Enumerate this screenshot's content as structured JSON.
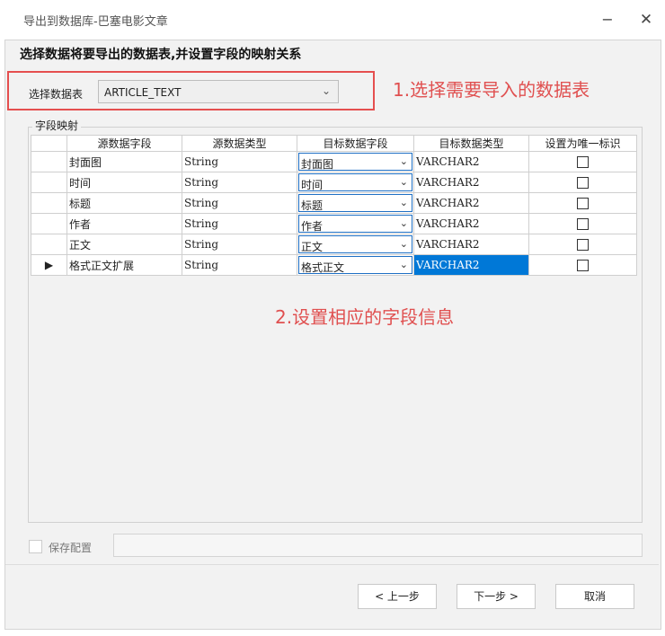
{
  "window": {
    "title": "导出到数据库-巴塞电影文章",
    "minimize_glyph": "−",
    "close_glyph": "✕"
  },
  "section_title": "选择数据将要导出的数据表,并设置字段的映射关系",
  "table_picker": {
    "label": "选择数据表",
    "value": "ARTICLE_TEXT"
  },
  "annotations": {
    "step1": "1.选择需要导入的数据表",
    "step2": "2.设置相应的字段信息"
  },
  "mapping": {
    "legend": "字段映射",
    "headers": [
      "源数据字段",
      "源数据类型",
      "目标数据字段",
      "目标数据类型",
      "设置为唯一标识"
    ],
    "current_row_marker": "▶",
    "rows": [
      {
        "source": "封面图",
        "type": "String",
        "target": "封面图",
        "target_type": "VARCHAR2",
        "unique": false
      },
      {
        "source": "时间",
        "type": "String",
        "target": "时间",
        "target_type": "VARCHAR2",
        "unique": false
      },
      {
        "source": "标题",
        "type": "String",
        "target": "标题",
        "target_type": "VARCHAR2",
        "unique": false
      },
      {
        "source": "作者",
        "type": "String",
        "target": "作者",
        "target_type": "VARCHAR2",
        "unique": false
      },
      {
        "source": "正文",
        "type": "String",
        "target": "正文",
        "target_type": "VARCHAR2",
        "unique": false
      },
      {
        "source": "格式正文扩展",
        "type": "String",
        "target": "格式正文",
        "target_type": "VARCHAR2",
        "unique": false
      }
    ]
  },
  "save_config": {
    "label": "保存配置",
    "checked": false,
    "value": ""
  },
  "buttons": {
    "prev": "< 上一步",
    "next": "下一步 >",
    "cancel": "取消"
  },
  "colors": {
    "annotation": "#e05050",
    "selection": "#0078d7",
    "highlight_box": "#e54f4f"
  }
}
